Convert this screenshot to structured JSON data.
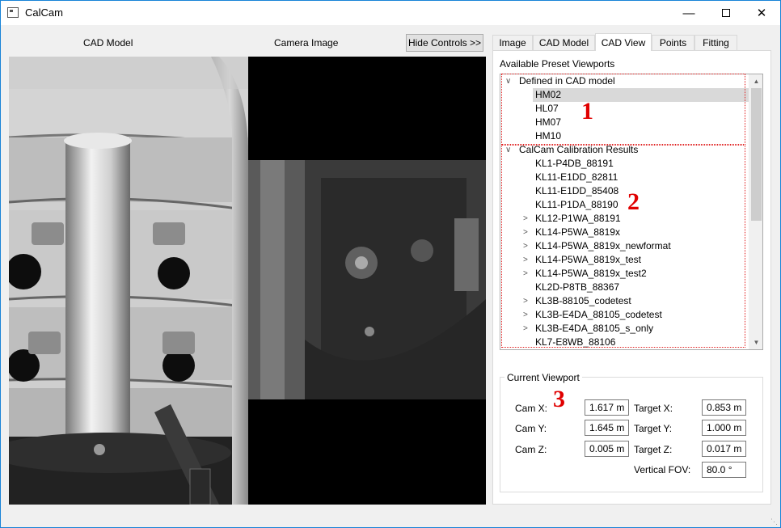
{
  "window": {
    "title": "CalCam",
    "icon": "app-window-icon"
  },
  "views": {
    "cad_label": "CAD Model",
    "camera_label": "Camera Image"
  },
  "toolbar": {
    "hide_controls": "Hide Controls >>"
  },
  "tabs": [
    {
      "label": "Image"
    },
    {
      "label": "CAD Model"
    },
    {
      "label": "CAD View",
      "active": true
    },
    {
      "label": "Points"
    },
    {
      "label": "Fitting"
    }
  ],
  "presets": {
    "group_label": "Available Preset Viewports",
    "cad_group": {
      "label": "Defined in CAD model",
      "items": [
        "HM02",
        "HL07",
        "HM07",
        "HM10"
      ],
      "selected": "HM02"
    },
    "calib_group": {
      "label": "CalCam Calibration Results",
      "items": [
        {
          "label": "KL1-P4DB_88191",
          "expandable": false
        },
        {
          "label": "KL11-E1DD_82811",
          "expandable": false
        },
        {
          "label": "KL11-E1DD_85408",
          "expandable": false
        },
        {
          "label": "KL11-P1DA_88190",
          "expandable": false
        },
        {
          "label": "KL12-P1WA_88191",
          "expandable": true
        },
        {
          "label": "KL14-P5WA_8819x",
          "expandable": true
        },
        {
          "label": "KL14-P5WA_8819x_newformat",
          "expandable": true
        },
        {
          "label": "KL14-P5WA_8819x_test",
          "expandable": true
        },
        {
          "label": "KL14-P5WA_8819x_test2",
          "expandable": true
        },
        {
          "label": "KL2D-P8TB_88367",
          "expandable": false
        },
        {
          "label": "KL3B-88105_codetest",
          "expandable": true
        },
        {
          "label": "KL3B-E4DA_88105_codetest",
          "expandable": true
        },
        {
          "label": "KL3B-E4DA_88105_s_only",
          "expandable": true
        },
        {
          "label": "KL7-E8WB_88106",
          "expandable": false
        }
      ]
    }
  },
  "annotations": [
    "1",
    "2",
    "3"
  ],
  "current_viewport": {
    "title": "Current Viewport",
    "cam_x_label": "Cam X:",
    "cam_x": "1.617 m",
    "cam_y_label": "Cam Y:",
    "cam_y": "1.645 m",
    "cam_z_label": "Cam Z:",
    "cam_z": "0.005 m",
    "target_x_label": "Target X:",
    "target_x": "0.853 m",
    "target_y_label": "Target Y:",
    "target_y": "1.000 m",
    "target_z_label": "Target Z:",
    "target_z": "0.017 m",
    "fov_label": "Vertical FOV:",
    "fov": "80.0 °"
  },
  "colors": {
    "annotation_red": "#e00000",
    "selection": "#d9d9d9",
    "title_border": "#1883d7"
  }
}
